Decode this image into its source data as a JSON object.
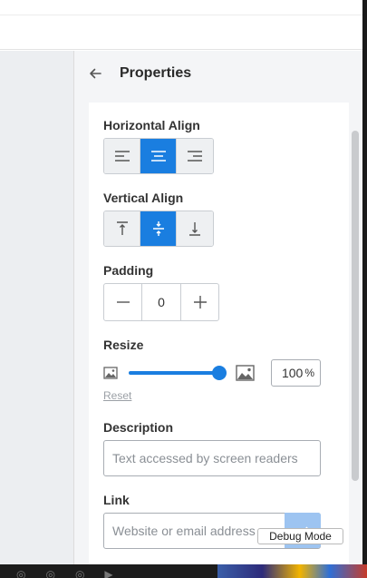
{
  "panel": {
    "title": "Properties"
  },
  "horizontal_align": {
    "label": "Horizontal Align",
    "options": [
      "align-left",
      "align-center",
      "align-right"
    ],
    "selected": "align-center"
  },
  "vertical_align": {
    "label": "Vertical Align",
    "options": [
      "align-top",
      "align-middle",
      "align-bottom"
    ],
    "selected": "align-middle"
  },
  "padding": {
    "label": "Padding",
    "value": "0"
  },
  "resize": {
    "label": "Resize",
    "value": "100",
    "unit": "%",
    "slider_fraction": 1.0,
    "reset_label": "Reset"
  },
  "description": {
    "label": "Description",
    "placeholder": "Text accessed by screen readers"
  },
  "link": {
    "label": "Link",
    "placeholder": "Website or email address"
  },
  "debug": {
    "label": "Debug Mode"
  },
  "colors": {
    "accent": "#1a7ee0",
    "accent_light": "#9dc4f1",
    "panel_bg": "#f4f5f7"
  }
}
